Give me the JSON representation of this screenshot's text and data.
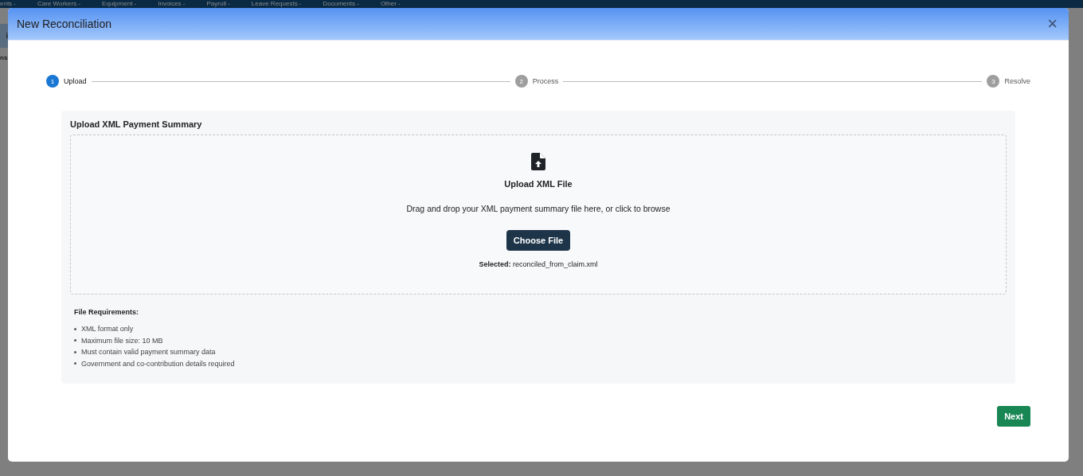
{
  "background_nav": {
    "items": [
      "ents -",
      "Care Workers -",
      "Equipment -",
      "Invoices -",
      "Payroll -",
      "Leave Requests -",
      "Documents -",
      "Other -"
    ]
  },
  "background_fragments": [
    "i",
    "ns"
  ],
  "modal": {
    "title": "New Reconciliation",
    "close": "×",
    "steps": [
      {
        "number": "1",
        "label": "Upload",
        "selected": true
      },
      {
        "number": "2",
        "label": "Process",
        "selected": false
      },
      {
        "number": "3",
        "label": "Resolve",
        "selected": false
      }
    ],
    "panel_title": "Upload XML Payment Summary",
    "dropzone": {
      "heading": "Upload XML File",
      "hint": "Drag and drop your XML payment summary file here, or click to browse",
      "button": "Choose File",
      "selected_label": "**Selected:** reconciled_from_claim.xml"
    },
    "requirements_title": "File Requirements:",
    "requirements": [
      "XML format only",
      "Maximum file size: 10 MB",
      "Must contain valid payment summary data",
      "Government and co-contribution details required"
    ],
    "next_button": "Next"
  }
}
